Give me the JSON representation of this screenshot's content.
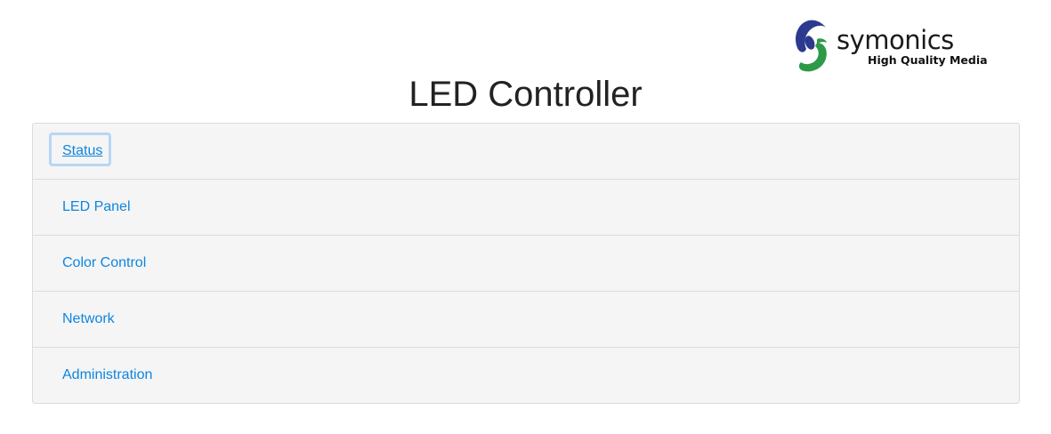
{
  "brand": {
    "name": "symonics",
    "tagline": "High Quality Media",
    "colors": {
      "blue": "#2b3a8f",
      "green": "#2e9a47"
    }
  },
  "page": {
    "title": "LED Controller"
  },
  "nav": {
    "items": [
      {
        "label": "Status",
        "active": true
      },
      {
        "label": "LED Panel",
        "active": false
      },
      {
        "label": "Color Control",
        "active": false
      },
      {
        "label": "Network",
        "active": false
      },
      {
        "label": "Administration",
        "active": false
      }
    ],
    "link_color": "#0d86e0",
    "panel_background": "#f5f5f5"
  }
}
